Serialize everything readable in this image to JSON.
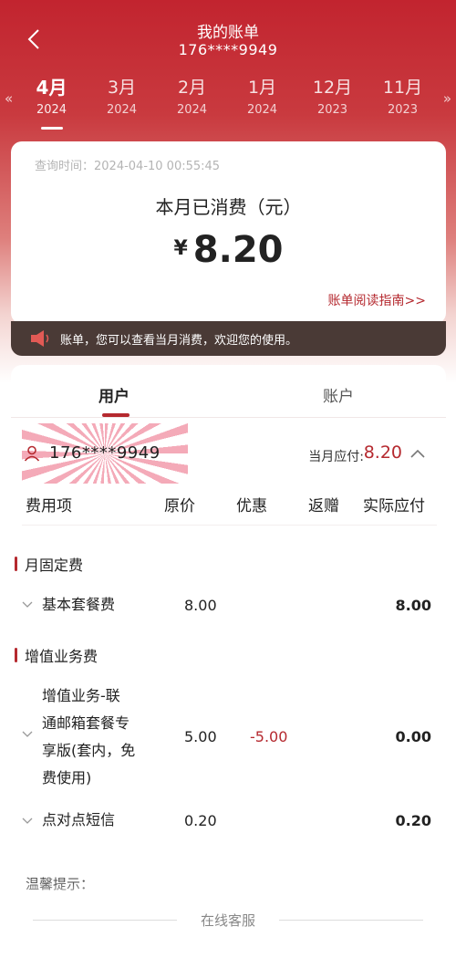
{
  "header": {
    "title": "我的账单",
    "phone": "176****9949",
    "prev_arrow": "«",
    "next_arrow": "»"
  },
  "months": [
    {
      "month": "4月",
      "year": "2024",
      "active": true
    },
    {
      "month": "3月",
      "year": "2024"
    },
    {
      "month": "2月",
      "year": "2024"
    },
    {
      "month": "1月",
      "year": "2024"
    },
    {
      "month": "12月",
      "year": "2023"
    },
    {
      "month": "11月",
      "year": "2023"
    }
  ],
  "summary": {
    "query_time": "查询时间：2024-04-10 00:55:45",
    "spent_label": "本月已消费（元）",
    "currency": "¥",
    "amount": "8.20",
    "guide_link": "账单阅读指南>>"
  },
  "notice": {
    "text": "账单，您可以查看当月消费，欢迎您的使用。"
  },
  "tabs": {
    "user": "用户",
    "account": "账户"
  },
  "account": {
    "number": "176****9949",
    "due_label": "当月应付:",
    "due_value": "8.20"
  },
  "table": {
    "headers": [
      "费用项",
      "原价",
      "优惠",
      "返赠",
      "实际应付"
    ],
    "sections": [
      {
        "title": "月固定费",
        "items": [
          {
            "name_lines": [
              "基本套餐费"
            ],
            "price": "8.00",
            "discount": "",
            "actual": "8.00"
          }
        ]
      },
      {
        "title": "增值业务费",
        "items": [
          {
            "name_lines": [
              "增值业务-联",
              "通邮箱套餐专",
              "享版(套内，免",
              "费使用)"
            ],
            "price": "5.00",
            "discount": "-5.00",
            "actual": "0.00"
          },
          {
            "name_lines": [
              "点对点短信"
            ],
            "price": "0.20",
            "discount": "",
            "actual": "0.20"
          }
        ]
      }
    ]
  },
  "tips": "温馨提示：",
  "footer": {
    "customer_service": "在线客服"
  },
  "colors": {
    "brand_red": "#c2242f",
    "accent_red": "#b5292f",
    "notice_bg": "#4a3a36"
  }
}
